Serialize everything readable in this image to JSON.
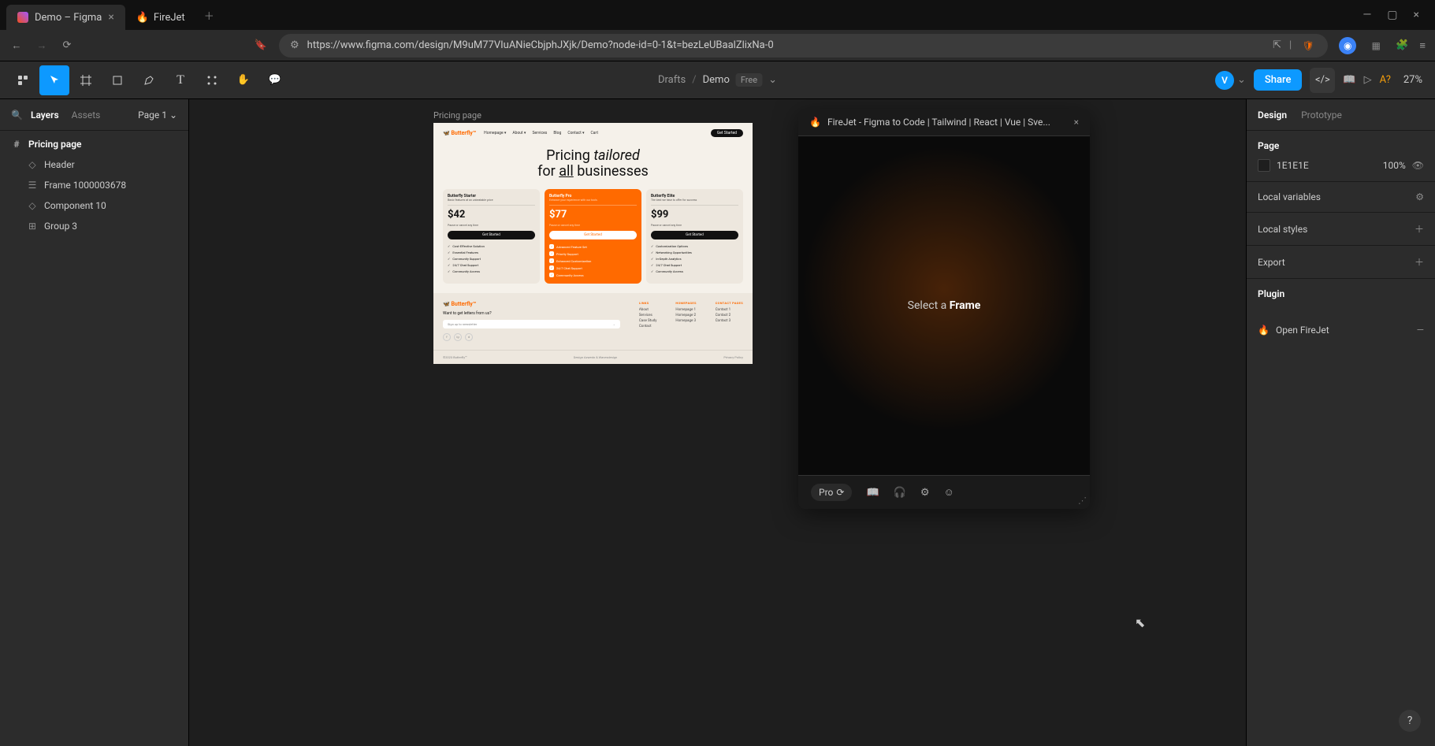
{
  "browser": {
    "tabs": [
      {
        "title": "Demo – Figma",
        "active": true,
        "icon": "figma"
      },
      {
        "title": "FireJet",
        "active": false,
        "icon": "fire"
      }
    ],
    "url": "https://www.figma.com/design/M9uM77VIuANieCbjphJXjk/Demo?node-id=0-1&t=bezLeUBaalZlixNa-0"
  },
  "figma": {
    "breadcrumb": {
      "drafts": "Drafts",
      "file": "Demo",
      "plan": "Free"
    },
    "share": "Share",
    "zoom": "27%",
    "avatar_initial": "V"
  },
  "left_panel": {
    "tabs": {
      "layers": "Layers",
      "assets": "Assets"
    },
    "page": "Page 1",
    "layers": [
      {
        "name": "Pricing page",
        "icon": "frame",
        "selected": true,
        "indent": 0
      },
      {
        "name": "Header",
        "icon": "component",
        "indent": 1
      },
      {
        "name": "Frame 1000003678",
        "icon": "frame",
        "indent": 1
      },
      {
        "name": "Component 10",
        "icon": "component",
        "indent": 1
      },
      {
        "name": "Group 3",
        "icon": "group",
        "indent": 1
      }
    ]
  },
  "canvas": {
    "frame_label": "Pricing page"
  },
  "design": {
    "brand": "Butterfly™",
    "nav": [
      "Homepage ▾",
      "About ▾",
      "Services",
      "Blog",
      "Contact ▾",
      "Cart"
    ],
    "cta": "Get Started",
    "hero_line1_a": "Pricing ",
    "hero_line1_b": "tailored",
    "hero_line2_a": "for ",
    "hero_line2_b": "all",
    "hero_line2_c": " businesses",
    "cards": [
      {
        "title": "Butterfly Starter",
        "sub": "Basic features at an unbeatable price",
        "price": "$42",
        "note": "Pause or cancel any time",
        "btn": "Get Started",
        "features": [
          "Cost-Effective Solution",
          "Essential Features",
          "Community Support",
          "24/7 Chat Support",
          "Community Access"
        ]
      },
      {
        "title": "Butterfly Pro",
        "sub": "Enhance your experience with our tools",
        "price": "$77",
        "note": "Pause or cancel any time",
        "btn": "Get Started",
        "features": [
          "Advanced Feature Set",
          "Priority Support",
          "Enhanced Customization",
          "24/7 Chat Support",
          "Community Access"
        ]
      },
      {
        "title": "Butterfly Elite",
        "sub": "The best we have to offer for success",
        "price": "$99",
        "note": "Pause or cancel any time",
        "btn": "Get Started",
        "features": [
          "Customization Options",
          "Networking Opportunities",
          "In-Depth Analytics",
          "24/7 Chat Support",
          "Community Access"
        ]
      }
    ],
    "footer": {
      "newsletter_q": "Want to get letters from us?",
      "newsletter_ph": "Sign up to newsletter",
      "cols": [
        {
          "h": "Links",
          "items": [
            "About",
            "Services",
            "Case Study",
            "Contact"
          ]
        },
        {
          "h": "Homepages",
          "items": [
            "Homepage 1",
            "Homepage 2",
            "Homepage 3"
          ]
        },
        {
          "h": "Contact Pages",
          "items": [
            "Contact 1",
            "Contact 2",
            "Contact 3"
          ]
        }
      ],
      "copyright": "©2023 Butterfly™",
      "credit": "Design Azwedo & Wavesdesign",
      "privacy": "Privacy Policy"
    }
  },
  "plugin": {
    "title": "FireJet - Figma to Code | Tailwind | React | Vue | Sve...",
    "message_a": "Select a ",
    "message_b": "Frame",
    "pro": "Pro"
  },
  "right_panel": {
    "tabs": {
      "design": "Design",
      "prototype": "Prototype"
    },
    "page_section": "Page",
    "bg_hex": "1E1E1E",
    "bg_opacity": "100%",
    "local_vars": "Local variables",
    "local_styles": "Local styles",
    "export": "Export",
    "plugin_section": "Plugin",
    "plugin_item": "Open FireJet"
  }
}
